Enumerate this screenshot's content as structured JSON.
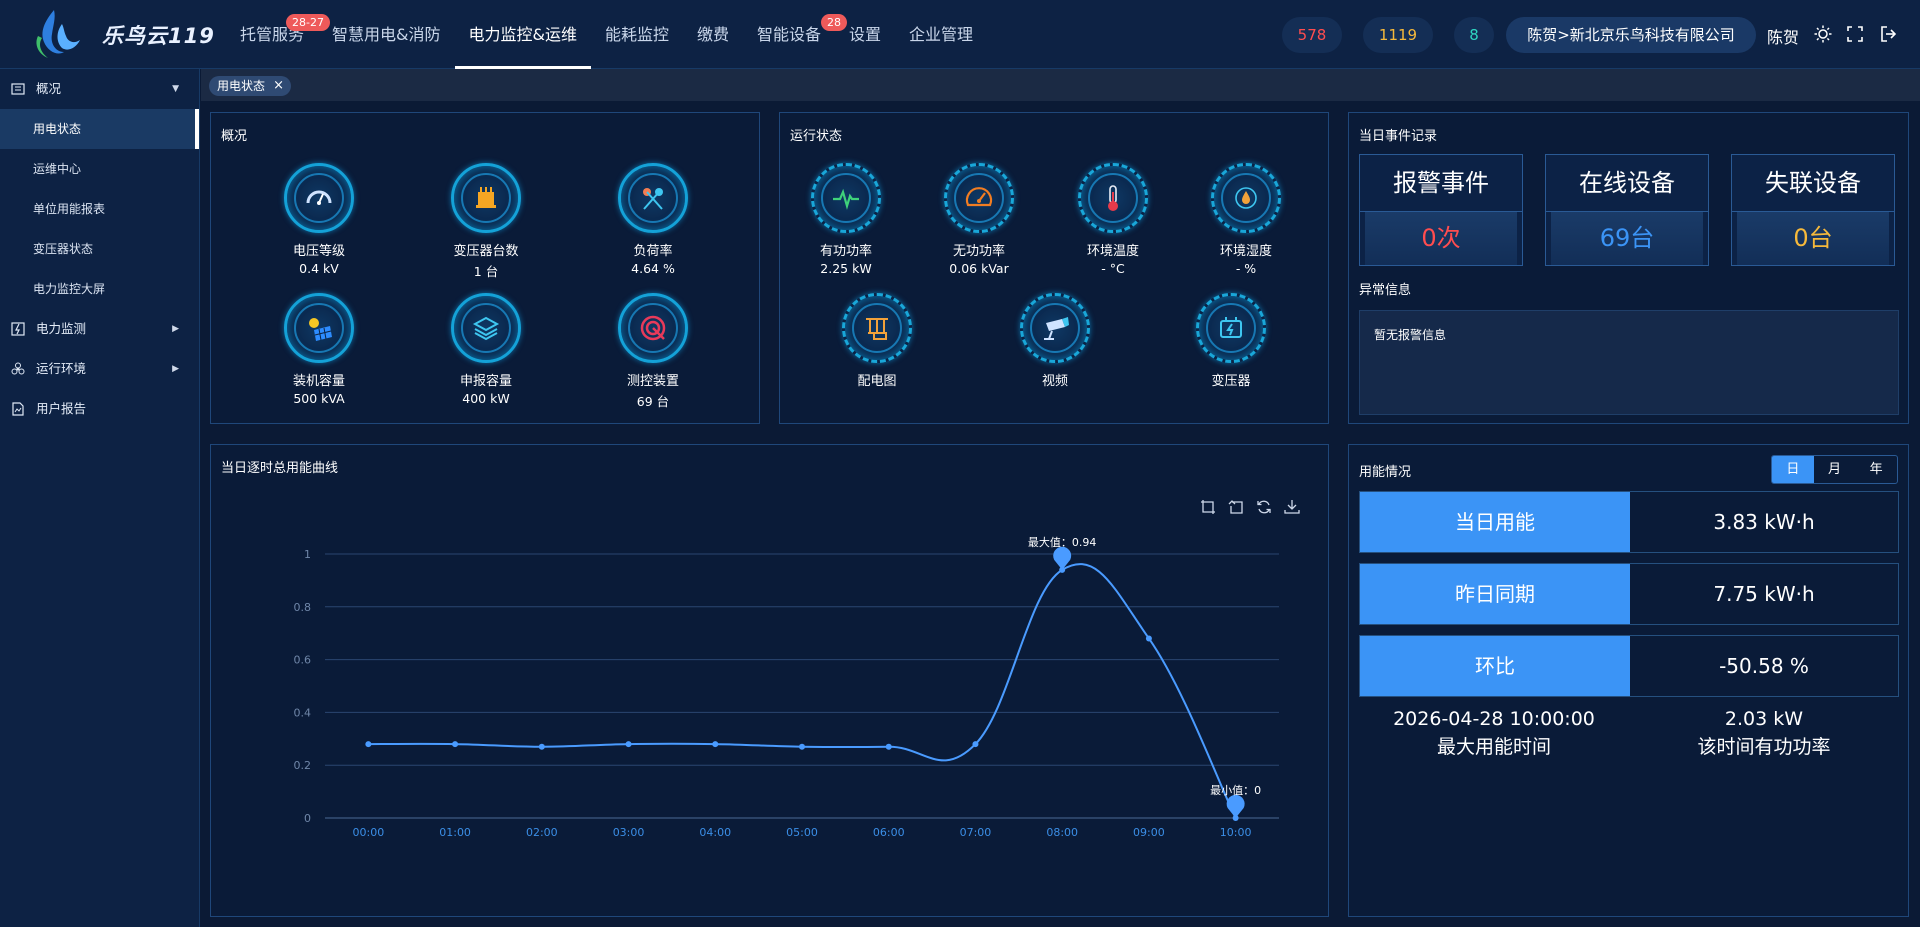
{
  "app": {
    "brand": "乐鸟云119"
  },
  "nav": {
    "items": [
      {
        "label": "托管服务",
        "badge": "28-27"
      },
      {
        "label": "智慧用电&消防",
        "badge": ""
      },
      {
        "label": "电力监控&运维",
        "badge": ""
      },
      {
        "label": "能耗监控",
        "badge": ""
      },
      {
        "label": "缴费",
        "badge": ""
      },
      {
        "label": "智能设备",
        "badge": "28"
      },
      {
        "label": "设置",
        "badge": ""
      },
      {
        "label": "企业管理",
        "badge": ""
      }
    ],
    "active_index": 2
  },
  "header": {
    "count_red": "578",
    "count_orange": "1119",
    "count_teal": "8",
    "company": "陈贺>新北京乐鸟科技有限公司",
    "user": "陈贺"
  },
  "sidebar": {
    "overview": "概况",
    "subitems": [
      "用电状态",
      "运维中心",
      "单位用能报表",
      "变压器状态",
      "电力监控大屏"
    ],
    "power_monitor": "电力监测",
    "environment": "运行环境",
    "report": "用户报告"
  },
  "tab": {
    "label": "用电状态",
    "close": "×"
  },
  "overview": {
    "title": "概况",
    "items": [
      {
        "label": "电压等级",
        "value": "0.4 kV"
      },
      {
        "label": "变压器台数",
        "value": "1 台"
      },
      {
        "label": "负荷率",
        "value": "4.64 %"
      },
      {
        "label": "装机容量",
        "value": "500 kVA"
      },
      {
        "label": "申报容量",
        "value": "400 kW"
      },
      {
        "label": "测控装置",
        "value": "69 台"
      }
    ]
  },
  "running": {
    "title": "运行状态",
    "items": [
      {
        "label": "有功功率",
        "value": "2.25 kW"
      },
      {
        "label": "无功功率",
        "value": "0.06 kVar"
      },
      {
        "label": "环境温度",
        "value": "- °C"
      },
      {
        "label": "环境湿度",
        "value": "- %"
      }
    ],
    "links": [
      "配电图",
      "视频",
      "变压器"
    ]
  },
  "events": {
    "title": "当日事件记录",
    "alarm_label": "报警事件",
    "alarm_value": "0次",
    "online_label": "在线设备",
    "online_value": "69台",
    "offline_label": "失联设备",
    "offline_value": "0台",
    "abnormal_title": "异常信息",
    "abnormal_text": "暂无报警信息"
  },
  "energy": {
    "title": "用能情况",
    "toggle": [
      "日",
      "月",
      "年"
    ],
    "rows": [
      {
        "label": "当日用能",
        "value": "3.83 kW·h"
      },
      {
        "label": "昨日同期",
        "value": "7.75 kW·h"
      },
      {
        "label": "环比",
        "value": "-50.58 %"
      }
    ],
    "max_time": "2026-04-28 10:00:00",
    "max_time_label": "最大用能时间",
    "power": "2.03 kW",
    "power_label": "该时间有功功率"
  },
  "chart_title": "当日逐时总用能曲线",
  "chart_data": {
    "type": "line",
    "title": "当日逐时总用能曲线",
    "x": [
      "00:00",
      "01:00",
      "02:00",
      "03:00",
      "04:00",
      "05:00",
      "06:00",
      "07:00",
      "08:00",
      "09:00",
      "10:00"
    ],
    "series": [
      {
        "values": [
          0.28,
          0.28,
          0.27,
          0.28,
          0.28,
          0.27,
          0.27,
          0.28,
          0.94,
          0.68,
          0
        ]
      }
    ],
    "ylim": [
      0,
      1
    ],
    "yticks": [
      "0",
      "0.2",
      "0.4",
      "0.6",
      "0.8",
      "1"
    ],
    "max_label": "最大值：0.94",
    "min_label": "最小值：0",
    "color": "#4a9bff",
    "grid": true
  }
}
